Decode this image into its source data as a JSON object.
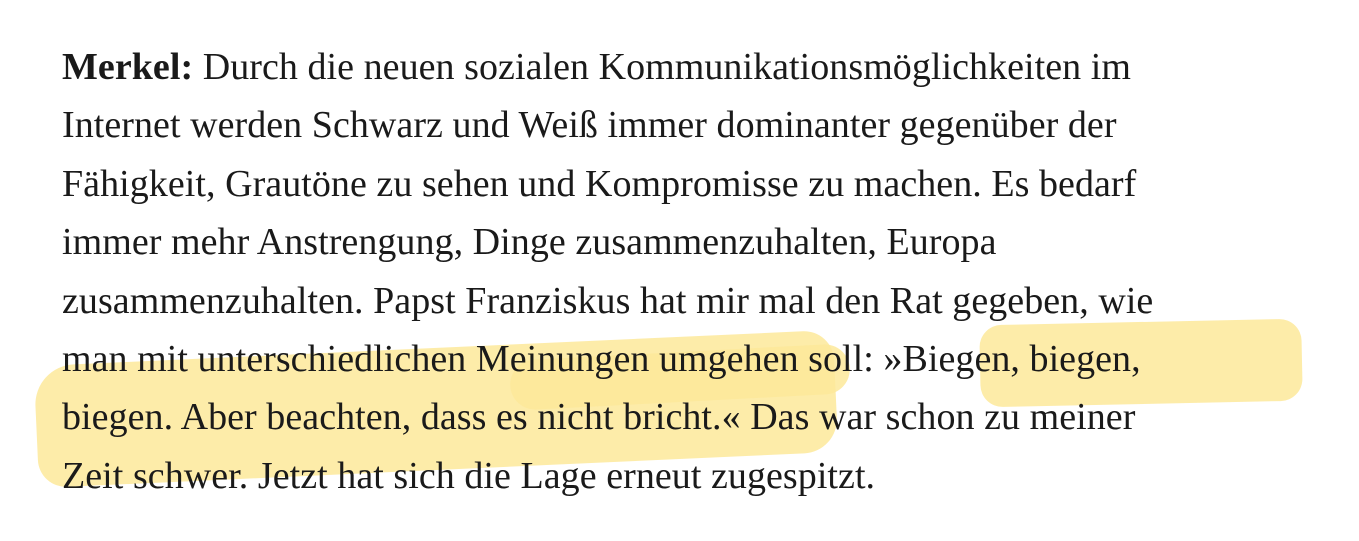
{
  "speaker_label": "Merkel:",
  "lines": [
    "Durch die neuen sozialen Kommunikationsmöglichkeiten im",
    "Internet werden Schwarz und Weiß immer dominanter gegenüber der",
    "Fähigkeit, Grautöne zu sehen und Kompromisse zu machen. Es bedarf",
    "immer mehr Anstrengung, Dinge zusammenzuhalten, Europa",
    "zusammenzuhalten. Papst Franziskus hat mir mal den Rat gegeben, wie",
    "man mit unterschiedlichen Meinungen umgehen soll: »Biegen, biegen,",
    "biegen. Aber beachten, dass es nicht bricht.« Das war schon zu meiner",
    "Zeit schwer. Jetzt hat sich die Lage erneut zugespitzt."
  ],
  "highlight_color": "#fde99a",
  "text_color": "#1a1a1a"
}
